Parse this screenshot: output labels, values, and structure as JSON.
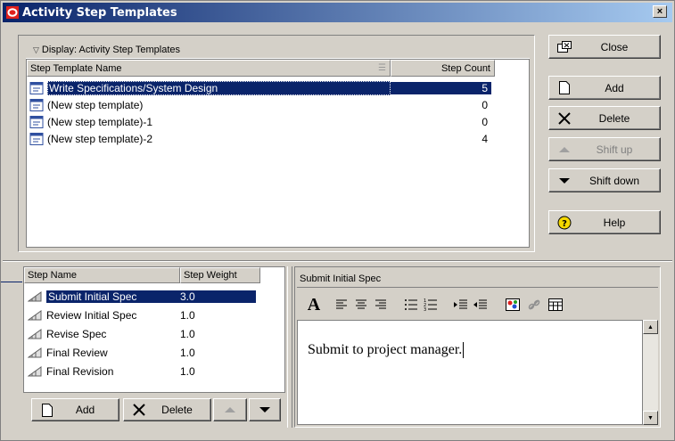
{
  "window": {
    "title": "Activity Step Templates",
    "close_glyph": "×"
  },
  "templates": {
    "display_label": "Display: Activity Step Templates",
    "columns": {
      "name": "Step Template Name",
      "count": "Step Count"
    },
    "rows": [
      {
        "name": "Write Specifications/System Design",
        "count": "5"
      },
      {
        "name": "(New step template)",
        "count": "0"
      },
      {
        "name": "(New step template)-1",
        "count": "0"
      },
      {
        "name": "(New step template)-2",
        "count": "4"
      }
    ]
  },
  "side_buttons": {
    "close": "Close",
    "add": "Add",
    "delete": "Delete",
    "shift_up": "Shift up",
    "shift_down": "Shift down",
    "help": "Help"
  },
  "steps": {
    "columns": {
      "name": "Step Name",
      "weight": "Step Weight"
    },
    "rows": [
      {
        "name": "Submit Initial Spec",
        "weight": "3.0"
      },
      {
        "name": "Review Initial Spec",
        "weight": "1.0"
      },
      {
        "name": "Revise Spec",
        "weight": "1.0"
      },
      {
        "name": "Final Review",
        "weight": "1.0"
      },
      {
        "name": "Final Revision",
        "weight": "1.0"
      }
    ],
    "buttons": {
      "add": "Add",
      "delete": "Delete"
    }
  },
  "editor": {
    "title": "Submit Initial Spec",
    "content": "Submit to project manager."
  },
  "icons": {
    "app": "primavera-logo-icon",
    "template_row": "template-icon",
    "step_row": "step-icon"
  }
}
